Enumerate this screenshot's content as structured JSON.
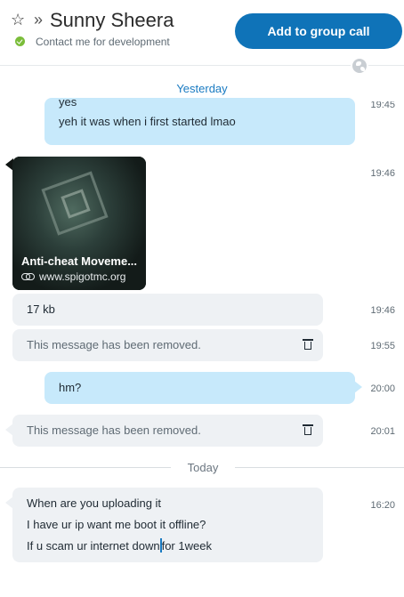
{
  "header": {
    "contact_name": "Sunny Sheera",
    "status": "Contact me for development",
    "add_group_call_label": "Add to group call"
  },
  "separators": {
    "yesterday": "Yesterday",
    "today": "Today"
  },
  "messages": [
    {
      "direction": "out",
      "lines": [
        "yes",
        "yeh it was when i first started lmao"
      ],
      "time": "19:45"
    },
    {
      "direction": "in",
      "type": "link-card",
      "title": "Anti-cheat Moveme...",
      "url": "www.spigotmc.org",
      "time": "19:46"
    },
    {
      "direction": "in",
      "lines": [
        "17 kb"
      ],
      "time": "19:46"
    },
    {
      "direction": "in",
      "removed": true,
      "text": "This message has been removed.",
      "time": "19:55"
    },
    {
      "direction": "out",
      "lines": [
        "hm?"
      ],
      "time": "20:00"
    },
    {
      "direction": "in",
      "removed": true,
      "text": "This message has been removed.",
      "time": "20:01"
    },
    {
      "direction": "in",
      "lines": [
        "When are you uploading it",
        "I have ur ip want me boot it offline?",
        "If u scam ur internet down",
        "for 1week"
      ],
      "time": "16:20"
    }
  ],
  "colors": {
    "accent": "#0f73b8",
    "outgoing_bubble": "#c7e9fb",
    "incoming_bubble": "#eef1f4",
    "online_status": "#7bbd3a",
    "date_label": "#1a7bc2"
  }
}
